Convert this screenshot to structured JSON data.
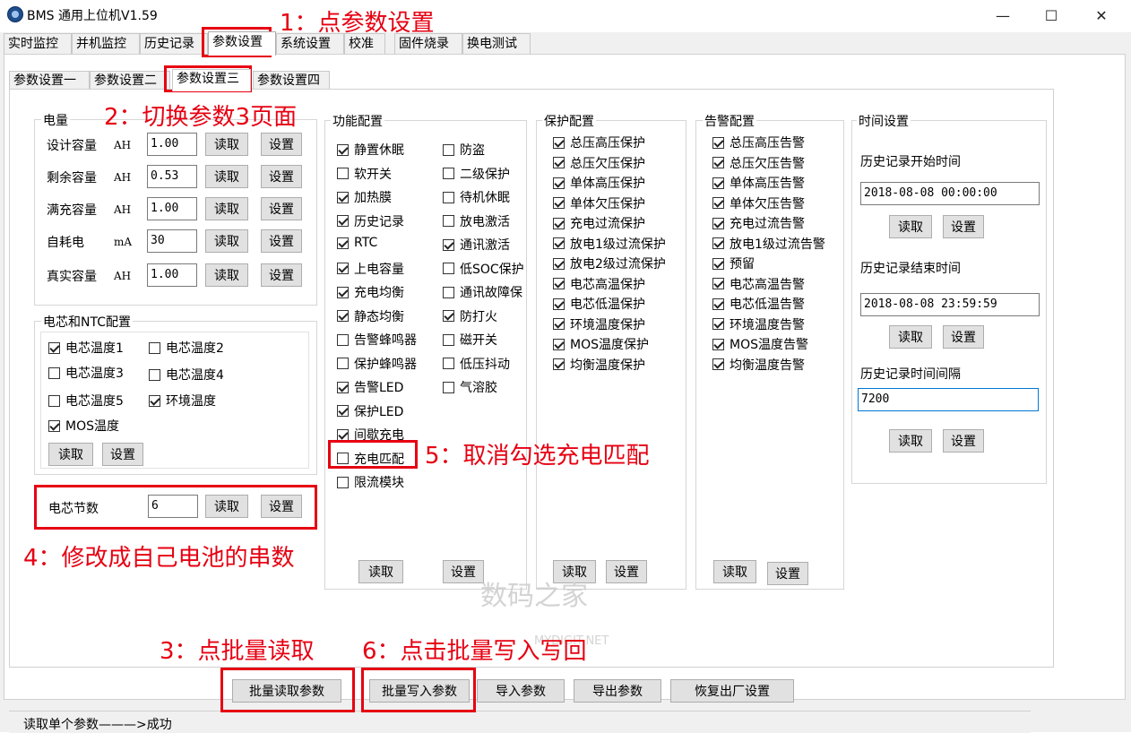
{
  "window": {
    "title": "BMS 通用上位机V1.59",
    "controls": [
      "—",
      "☐",
      "✕"
    ]
  },
  "tabs": [
    "实时监控",
    "并机监控",
    "历史记录",
    "参数设置",
    "系统设置",
    "校准",
    "固件烧录",
    "换电测试"
  ],
  "subtabs": [
    "参数设置一",
    "参数设置二",
    "参数设置三",
    "参数设置四"
  ],
  "capacity": {
    "title": "电量",
    "rows": [
      {
        "label": "设计容量",
        "unit": "AH",
        "value": "1.00"
      },
      {
        "label": "剩余容量",
        "unit": "AH",
        "value": "0.53"
      },
      {
        "label": "满充容量",
        "unit": "AH",
        "value": "1.00"
      },
      {
        "label": "自耗电",
        "unit": "mA",
        "value": "30"
      },
      {
        "label": "真实容量",
        "unit": "AH",
        "value": "1.00"
      }
    ]
  },
  "ntc": {
    "title": "电芯和NTC配置",
    "items": [
      {
        "label": "电芯温度1",
        "checked": true
      },
      {
        "label": "电芯温度2",
        "checked": false
      },
      {
        "label": "电芯温度3",
        "checked": false
      },
      {
        "label": "电芯温度4",
        "checked": false
      },
      {
        "label": "电芯温度5",
        "checked": false
      },
      {
        "label": "环境温度",
        "checked": true
      },
      {
        "label": "MOS温度",
        "checked": true
      }
    ]
  },
  "cells": {
    "label": "电芯节数",
    "value": "6"
  },
  "buttons": {
    "read": "读取",
    "set": "设置"
  },
  "function_cfg": {
    "title": "功能配置",
    "col1": [
      {
        "label": "静置休眠",
        "checked": true
      },
      {
        "label": "软开关",
        "checked": false
      },
      {
        "label": "加热膜",
        "checked": true
      },
      {
        "label": "历史记录",
        "checked": true
      },
      {
        "label": "RTC",
        "checked": true
      },
      {
        "label": "上电容量",
        "checked": true
      },
      {
        "label": "充电均衡",
        "checked": true
      },
      {
        "label": "静态均衡",
        "checked": true
      },
      {
        "label": "告警蜂鸣器",
        "checked": false
      },
      {
        "label": "保护蜂鸣器",
        "checked": false
      },
      {
        "label": "告警LED",
        "checked": true
      },
      {
        "label": "保护LED",
        "checked": true
      },
      {
        "label": "间歇充电",
        "checked": true
      },
      {
        "label": "充电匹配",
        "checked": false
      },
      {
        "label": "限流模块",
        "checked": false
      }
    ],
    "col2": [
      {
        "label": "防盗",
        "checked": false
      },
      {
        "label": "二级保护",
        "checked": false
      },
      {
        "label": "待机休眠",
        "checked": false
      },
      {
        "label": "放电激活",
        "checked": false
      },
      {
        "label": "通讯激活",
        "checked": true
      },
      {
        "label": "低SOC保护",
        "checked": false
      },
      {
        "label": "通讯故障保",
        "checked": false
      },
      {
        "label": "防打火",
        "checked": true
      },
      {
        "label": "磁开关",
        "checked": false
      },
      {
        "label": "低压抖动",
        "checked": false
      },
      {
        "label": "气溶胶",
        "checked": false
      }
    ]
  },
  "protect_cfg": {
    "title": "保护配置",
    "items": [
      "总压高压保护",
      "总压欠压保护",
      "单体高压保护",
      "单体欠压保护",
      "充电过流保护",
      "放电1级过流保护",
      "放电2级过流保护",
      "电芯高温保护",
      "电芯低温保护",
      "环境温度保护",
      "MOS温度保护",
      "均衡温度保护"
    ]
  },
  "alarm_cfg": {
    "title": "告警配置",
    "items": [
      "总压高压告警",
      "总压欠压告警",
      "单体高压告警",
      "单体欠压告警",
      "充电过流告警",
      "放电1级过流告警",
      "预留",
      "电芯高温告警",
      "电芯低温告警",
      "环境温度告警",
      "MOS温度告警",
      "均衡温度告警"
    ]
  },
  "time_cfg": {
    "title": "时间设置",
    "start_label": "历史记录开始时间",
    "start_value": "2018-08-08 00:00:00",
    "end_label": "历史记录结束时间",
    "end_value": "2018-08-08 23:59:59",
    "interval_label": "历史记录时间间隔",
    "interval_value": "7200"
  },
  "bottom_buttons": [
    "批量读取参数",
    "批量写入参数",
    "导入参数",
    "导出参数",
    "恢复出厂设置"
  ],
  "status": "读取单个参数———>成功",
  "watermark": {
    "main": "数码之家",
    "sub": "MYDIGIT.NET"
  },
  "annotations": {
    "a1": "1：点参数设置",
    "a2": "2：切换参数3页面",
    "a3": "3：点批量读取",
    "a4": "4：修改成自己电池的串数",
    "a5": "5：取消勾选充电匹配",
    "a6": "6：点击批量写入写回"
  },
  "colors": {
    "annotation": "#e60012",
    "focus_border": "#0078d7"
  }
}
